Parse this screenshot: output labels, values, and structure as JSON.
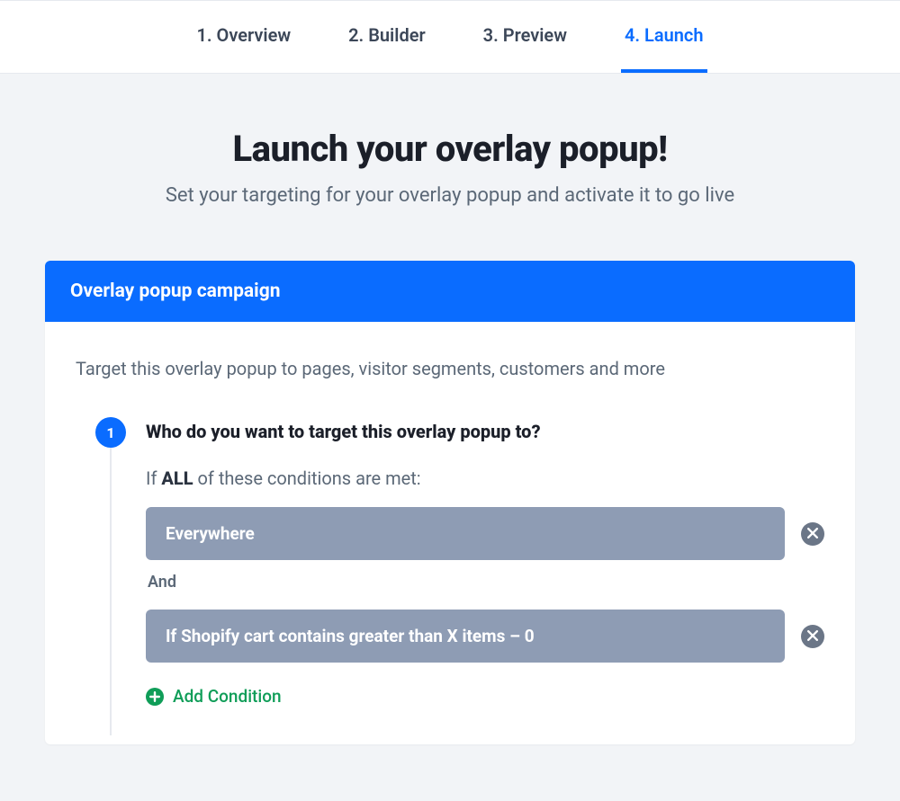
{
  "tabs": [
    {
      "label": "1. Overview",
      "active": false
    },
    {
      "label": "2. Builder",
      "active": false
    },
    {
      "label": "3. Preview",
      "active": false
    },
    {
      "label": "4. Launch",
      "active": true
    }
  ],
  "hero": {
    "title": "Launch your overlay popup!",
    "subtitle": "Set your targeting for your overlay popup and activate it to go live"
  },
  "panel": {
    "header": "Overlay popup campaign",
    "desc": "Target this overlay popup to pages, visitor segments, customers and more"
  },
  "step": {
    "number": "1",
    "title": "Who do you want to target this overlay popup to?",
    "intro_prefix": "If ",
    "intro_bold": "ALL",
    "intro_suffix": " of these conditions are met:",
    "conditions": [
      "Everywhere",
      "If Shopify cart contains greater than X items – 0"
    ],
    "connector": "And",
    "add_label": "Add Condition"
  }
}
